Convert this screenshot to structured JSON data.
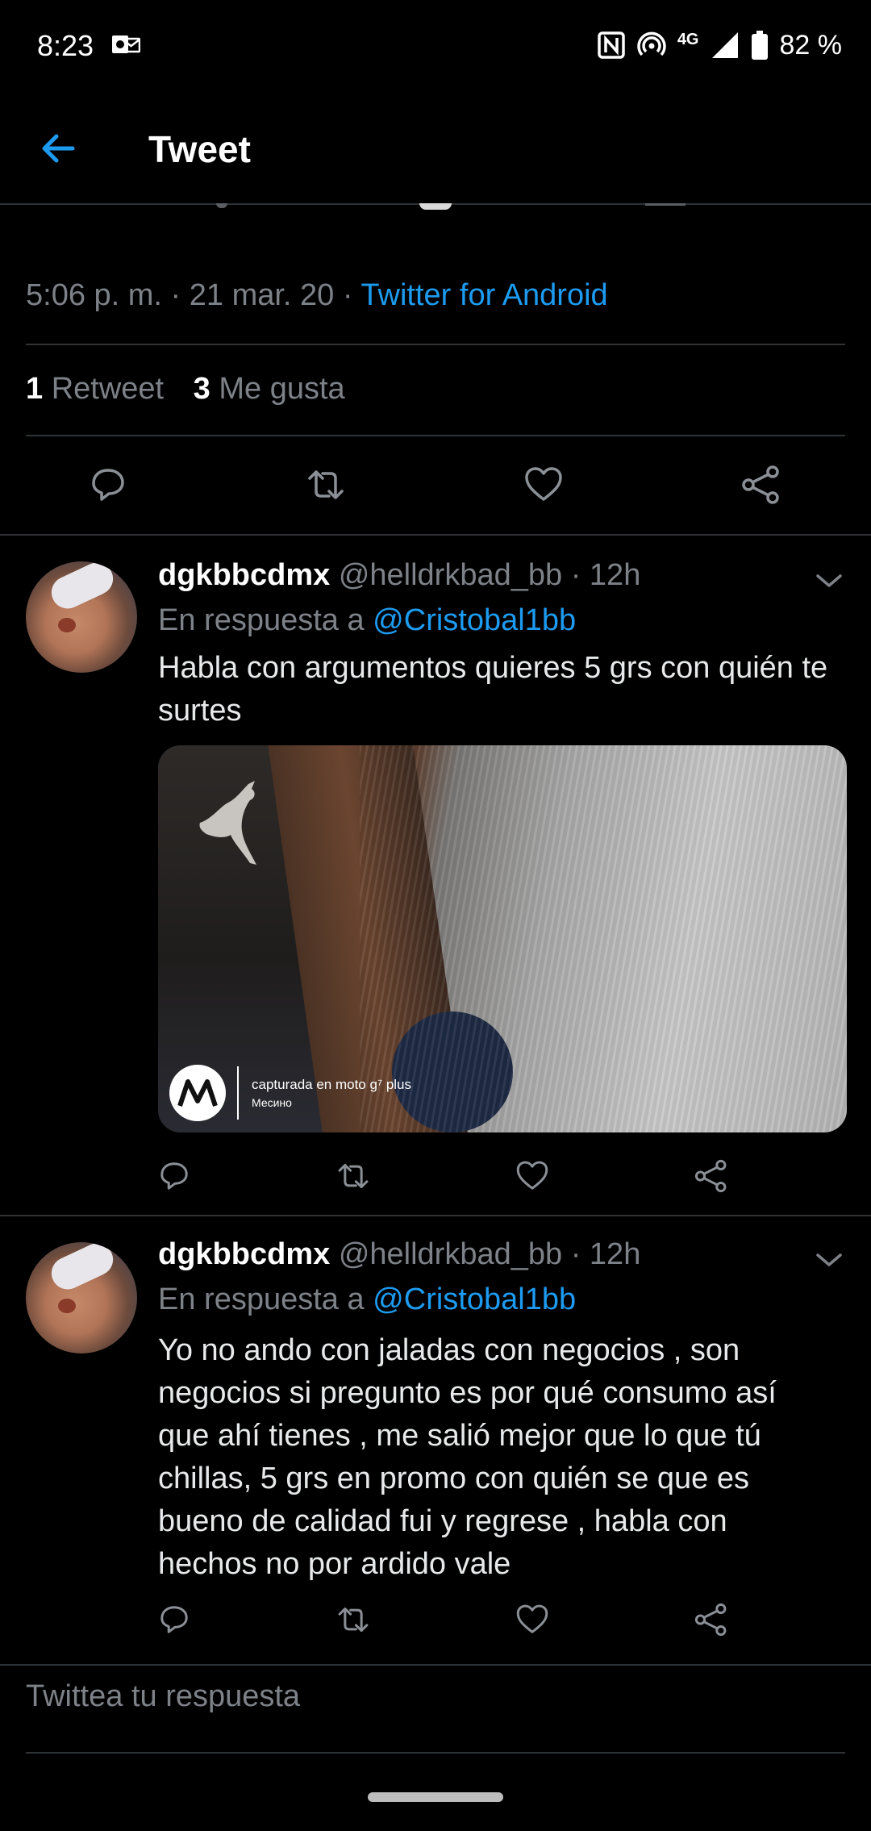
{
  "status_bar": {
    "time": "8:23",
    "network": "4G",
    "battery": "82 %"
  },
  "app_bar": {
    "title": "Tweet"
  },
  "tweet_meta": {
    "time": "5:06 p. m.",
    "sep1": "·",
    "date": "21 mar. 20",
    "sep2": "·",
    "source": "Twitter for Android"
  },
  "stats": {
    "retweets_count": "1",
    "retweets_label": "Retweet",
    "likes_count": "3",
    "likes_label": "Me gusta"
  },
  "replies": [
    {
      "display_name": "dgkbbcdmx",
      "handle": "@helldrkbad_bb",
      "sep": "·",
      "age": "12h",
      "reply_prefix": "En respuesta a",
      "reply_to": "@Cristobal1bb",
      "text": "Habla con argumentos quieres 5 grs con quién te surtes",
      "media": {
        "watermark_line1": "capturada en moto g⁷ plus",
        "watermark_line2": "Месино"
      }
    },
    {
      "display_name": "dgkbbcdmx",
      "handle": "@helldrkbad_bb",
      "sep": "·",
      "age": "12h",
      "reply_prefix": "En respuesta a",
      "reply_to": "@Cristobal1bb",
      "text_lines": [
        "Yo no ando con jaladas con negocios , son",
        "negocios si pregunto es por qué consumo así",
        "que ahí tienes , me salió mejor que  lo que tú",
        "chillas, 5 grs  en promo con quién se que es",
        "bueno de calidad fui y regrese , habla con",
        "hechos no por ardido vale"
      ]
    }
  ],
  "compose": {
    "placeholder": "Twittea tu respuesta"
  },
  "colors": {
    "accent": "#1d9bf0",
    "background": "#000000",
    "divider": "#2f3336",
    "muted": "#7d8288"
  }
}
